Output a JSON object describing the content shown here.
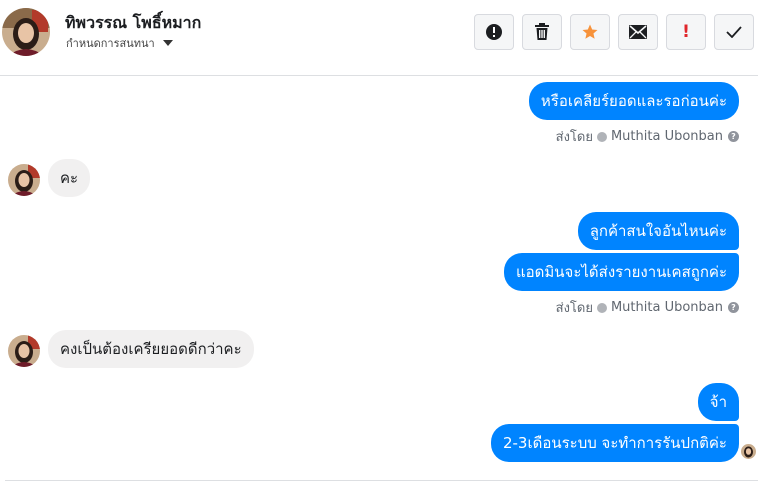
{
  "header": {
    "contact_name": "ทิพวรรณ โพธิ์หมาก",
    "subtitle": "กำหนดการสนทนา"
  },
  "toolbar": {
    "buttons": [
      {
        "icon": "alert-circle-icon"
      },
      {
        "icon": "trash-icon"
      },
      {
        "icon": "star-icon"
      },
      {
        "icon": "envelope-icon"
      },
      {
        "icon": "exclamation-icon",
        "glyph": "!"
      },
      {
        "icon": "checkmark-icon"
      }
    ]
  },
  "messages": [
    {
      "direction": "out",
      "text": "หรือเคลียร์ยอดและรอก่อนค่ะ"
    },
    {
      "direction": "in",
      "text": "คะ"
    },
    {
      "direction": "out",
      "text": "ลูกค้าสนใจอันไหนค่ะ"
    },
    {
      "direction": "out",
      "text": "แอดมินจะได้ส่งรายงานเคสถูกค่ะ"
    },
    {
      "direction": "in",
      "text": "คงเป็นต้องเครียยอดดีกว่าคะ"
    },
    {
      "direction": "out",
      "text": "จ้า"
    },
    {
      "direction": "out",
      "text": "2-3เดือนระบบ จะทำการรันปกติค่ะ"
    }
  ],
  "sent_by": {
    "prefix": "ส่งโดย",
    "name": "Muthita Ubonban",
    "help": "?"
  },
  "colors": {
    "outgoing_bubble": "#0084ff",
    "incoming_bubble": "#f1f0f0",
    "star": "#f7923a",
    "exclamation": "#e0262b"
  }
}
